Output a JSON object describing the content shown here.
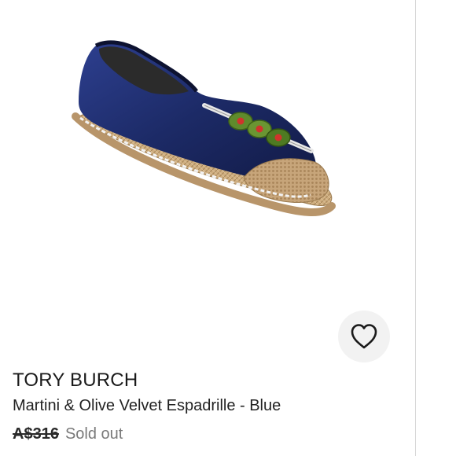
{
  "product": {
    "brand": "TORY BURCH",
    "title": "Martini & Olive Velvet Espadrille - Blue",
    "price": "A$316",
    "status": "Sold out",
    "image_icon": "shoe-image"
  },
  "favorite": {
    "icon": "heart-icon"
  },
  "colors": {
    "velvet_blue": "#1f2f6e",
    "jute": "#c9a97a",
    "olive_green": "#5f8a2c",
    "pimento_red": "#d0342c",
    "sold_out_grey": "#7a7a7a"
  }
}
